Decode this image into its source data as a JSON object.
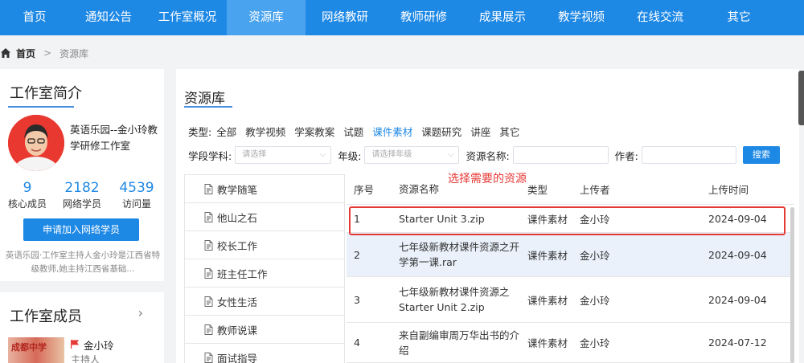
{
  "nav": {
    "items": [
      {
        "label": "首页"
      },
      {
        "label": "通知公告"
      },
      {
        "label": "工作室概况"
      },
      {
        "label": "资源库"
      },
      {
        "label": "网络教研"
      },
      {
        "label": "教师研修"
      },
      {
        "label": "成果展示"
      },
      {
        "label": "教学视频"
      },
      {
        "label": "在线交流"
      },
      {
        "label": "其它"
      }
    ],
    "active_index": 3
  },
  "breadcrumb": {
    "home": "首页",
    "separator": ">",
    "current": "资源库"
  },
  "intro": {
    "title": "工作室简介",
    "name": "英语乐园--金小玲教学研修工作室",
    "stats": [
      {
        "value": "9",
        "label": "核心成员"
      },
      {
        "value": "2182",
        "label": "网络学员"
      },
      {
        "value": "4539",
        "label": "访问量"
      }
    ],
    "join_button": "申请加入网络学员",
    "description": "英语乐园·工作室主持人金小玲是江西省特级教师,她主持江西省基础..."
  },
  "members": {
    "title": "工作室成员",
    "chevron": "›",
    "photo_text": "成都中学",
    "member_name": "金小玲",
    "member_role": "主持人"
  },
  "main": {
    "title": "资源库",
    "type_label": "类型:",
    "types": [
      "全部",
      "教学视频",
      "学案教案",
      "试题",
      "课件素材",
      "课题研究",
      "讲座",
      "其它"
    ],
    "active_type": 4,
    "filters": {
      "subject_label": "学段学科:",
      "subject_placeholder": "请选择",
      "grade_label": "年级:",
      "grade_placeholder": "请选择年级",
      "name_label": "资源名称:",
      "author_label": "作者:",
      "search_button": "搜索"
    },
    "categories": [
      "教学随笔",
      "他山之石",
      "校长工作",
      "班主任工作",
      "女性生活",
      "教师说课",
      "面试指导"
    ],
    "table": {
      "headers": [
        "序号",
        "资源名称",
        "类型",
        "上传者",
        "上传时间"
      ],
      "rows": [
        {
          "no": "1",
          "name": "Starter Unit 3.zip",
          "type": "课件素材",
          "uploader": "金小玲",
          "date": "2024-09-04"
        },
        {
          "no": "2",
          "name": "七年级新教材课件资源之开学第一课.rar",
          "type": "课件素材",
          "uploader": "金小玲",
          "date": "2024-09-04"
        },
        {
          "no": "3",
          "name": "七年级新教材课件资源之Starter Unit 2.zip",
          "type": "课件素材",
          "uploader": "金小玲",
          "date": "2024-09-04"
        },
        {
          "no": "4",
          "name": "来自副编审周万华出书的介绍",
          "type": "课件素材",
          "uploader": "金小玲",
          "date": "2024-07-12"
        }
      ]
    }
  },
  "annotation": {
    "text": "选择需要的资源"
  },
  "colors": {
    "primary": "#1e88e5",
    "nav_active": "#4aa3ee",
    "highlight": "#e53935",
    "row_highlight": "#eaf1fb"
  }
}
